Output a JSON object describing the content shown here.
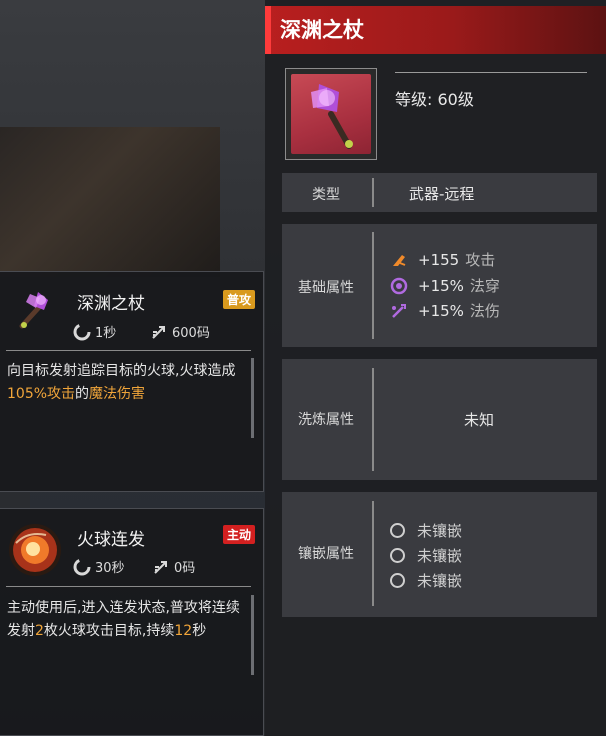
{
  "colors": {
    "title_red": "#b91f1f",
    "highlight_orange": "#f0a53a",
    "tag_normal": "#d99a1e",
    "tag_active": "#d32020"
  },
  "skills": [
    {
      "name": "深渊之杖",
      "tag": "普攻",
      "icon": "staff-icon",
      "cooldown": "1秒",
      "range": "600码",
      "desc_parts": [
        "向目标发射追踪目标的火球,火球造成",
        "105%攻击",
        "的",
        "魔法伤害"
      ]
    },
    {
      "name": "火球连发",
      "tag": "主动",
      "icon": "fireball-icon",
      "cooldown": "30秒",
      "range": "0码",
      "desc_parts": [
        "主动使用后,进入连发状态,普攻将连续发射",
        "2",
        "枚火球攻击目标,持续",
        "12",
        "秒"
      ]
    }
  ],
  "item": {
    "title": "深渊之杖",
    "level": "等级: 60级",
    "type_label": "类型",
    "type_value": "武器-远程",
    "base_label": "基础属性",
    "stats": [
      {
        "icon": "attack-icon",
        "value": "+155",
        "name": "攻击"
      },
      {
        "icon": "penetration-icon",
        "value": "+15%",
        "name": "法穿"
      },
      {
        "icon": "magic-damage-icon",
        "value": "+15%",
        "name": "法伤"
      }
    ],
    "refine_label": "洗炼属性",
    "refine_value": "未知",
    "socket_label": "镶嵌属性",
    "sockets": [
      "未镶嵌",
      "未镶嵌",
      "未镶嵌"
    ]
  }
}
